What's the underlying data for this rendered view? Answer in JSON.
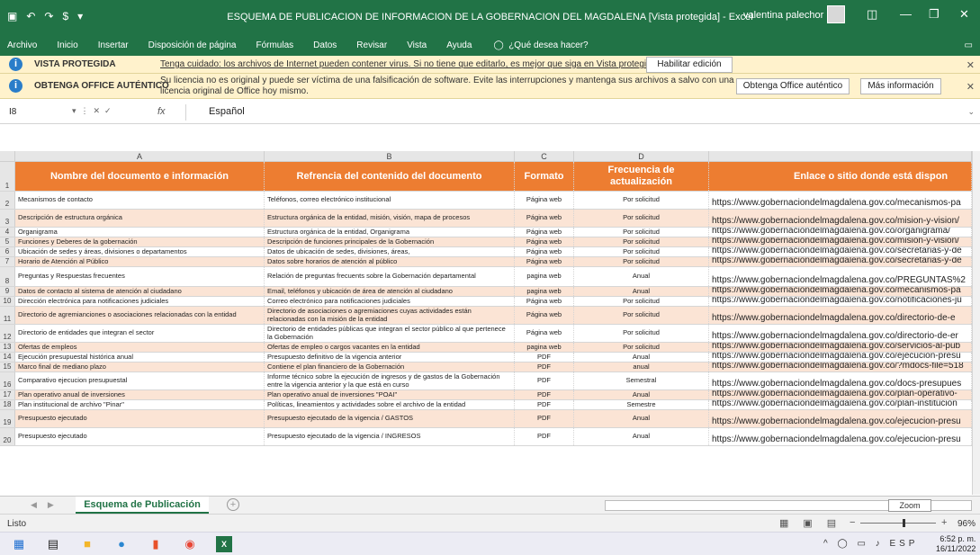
{
  "window": {
    "title": "ESQUEMA DE PUBLICACION DE INFORMACION DE LA GOBERNACION DEL MAGDALENA  [Vista protegida]  -  Excel",
    "user": "valentina palechor"
  },
  "ribbon": {
    "tabs": [
      "Archivo",
      "Inicio",
      "Insertar",
      "Disposición de página",
      "Fórmulas",
      "Datos",
      "Revisar",
      "Vista",
      "Ayuda"
    ],
    "tell_me": "¿Qué desea hacer?"
  },
  "protected_bar": {
    "label": "VISTA PROTEGIDA",
    "message": "Tenga cuidado: los archivos de Internet pueden contener virus. Si no tiene que editarlo, es mejor que siga en Vista protegida.",
    "button": "Habilitar edición"
  },
  "office_bar": {
    "label": "OBTENGA OFFICE AUTÉNTICO",
    "message_line1": "Su licencia no es original y puede ser víctima de una falsificación de software. Evite las interrupciones y mantenga sus archivos a salvo con una",
    "message_line2": "licencia original de Office hoy mismo.",
    "button1": "Obtenga Office auténtico",
    "button2": "Más información"
  },
  "formula_bar": {
    "name_box": "I8",
    "fx": "fx",
    "value": "Español"
  },
  "columns": [
    "A",
    "B",
    "C",
    "D"
  ],
  "header": {
    "row": "1",
    "a": "Nombre del documento e información",
    "b": "Refrencia del contenido del documento",
    "c": "Formato",
    "d": "Frecuencia de actualización",
    "e": "Enlace o sitio donde está dispon"
  },
  "rows": [
    {
      "n": "2",
      "a": "Mecanismos de contacto",
      "b": "Teléfonos, correo electrónico institucional",
      "c": "Página web",
      "d": "Por solicitud",
      "e": "https://www.gobernaciondelmagdalena.gov.co/mecanismos-pa"
    },
    {
      "n": "3",
      "a": "Descripción de estructura orgánica",
      "b": "Estructura orgánica de la entidad, misión, visión, mapa de procesos",
      "c": "Página web",
      "d": "Por solicitud",
      "e": "https://www.gobernaciondelmagdalena.gov.co/mision-y-vision/"
    },
    {
      "n": "4",
      "a": "Organigrama",
      "b": "Estructura orgánica de la entidad,  Organigrama",
      "c": "Página web",
      "d": "Por solicitud",
      "e": "https://www.gobernaciondelmagdalena.gov.co/organigrama/"
    },
    {
      "n": "5",
      "a": "Funciones y Deberes de la gobernación",
      "b": "Descripción de funciones principales de la Gobernación",
      "c": "Página web",
      "d": "Por solicitud",
      "e": "https://www.gobernaciondelmagdalena.gov.co/mision-y-vision/"
    },
    {
      "n": "6",
      "a": "Ubicación de sedes y áreas, divisiones o departamentos",
      "b": "Datos de ubicación de sedes, divisiones, áreas,",
      "c": "Página web",
      "d": "Por solicitud",
      "e": "https://www.gobernaciondelmagdalena.gov.co/secretarias-y-de"
    },
    {
      "n": "7",
      "a": "Horario de Atención al Público",
      "b": "Datos sobre horarios de atención al público",
      "c": "Página web",
      "d": "Por solicitud",
      "e": "https://www.gobernaciondelmagdalena.gov.co/secretarias-y-de"
    },
    {
      "n": "8",
      "a": "Preguntas y Respuestas frecuentes",
      "b": "Relación de preguntas frecuents sobre la Gobernación departamental",
      "c": "pagina web",
      "d": "Anual",
      "e": "https://www.gobernaciondelmagdalena.gov.co/PREGUNTAS%2"
    },
    {
      "n": "9",
      "a": "Datos de contacto al sistema de atención al ciudadano",
      "b": "Email, teléfonos y ubicación de área de atención al ciudadano",
      "c": "pagina web",
      "d": "Anual",
      "e": "https://www.gobernaciondelmagdalena.gov.co/mecanismos-pa"
    },
    {
      "n": "10",
      "a": "Dirección electrónica para notificaciones judiciales",
      "b": "Correo electrónico para notificaciones judiciales",
      "c": "Página web",
      "d": "Por solicitud",
      "e": "https://www.gobernaciondelmagdalena.gov.co/notificaciones-ju"
    },
    {
      "n": "11",
      "a": "Directorio de agremianciones o asociaciones relacionadas con la entidad",
      "b": "Directorio de asociaciones o agremiaciones cuyas actividades están relacionadas con la misión de la entidad",
      "c": "Página web",
      "d": "Por solicitud",
      "e": "https://www.gobernaciondelmagdalena.gov.co/directorio-de-e"
    },
    {
      "n": "12",
      "a": "Directorio de entidades que integran el sector",
      "b": "Directorio de entidades públicas que integran el sector público al que pertenece la Gobernación",
      "c": "Página web",
      "d": "Por solicitud",
      "e": "https://www.gobernaciondelmagdalena.gov.co/directorio-de-er"
    },
    {
      "n": "13",
      "a": "Ofertas de empleos",
      "b": "Ofertas de empleo o cargos vacantes en la entidad",
      "c": "pagina web",
      "d": "Por solicitud",
      "e": "https://www.gobernaciondelmagdalena.gov.co/servicios-al-pub"
    },
    {
      "n": "14",
      "a": "Ejecución presupuestal histórica anual",
      "b": "Presupuesto definitivo de la vigencia anterior",
      "c": "PDF",
      "d": "Anual",
      "e": "https://www.gobernaciondelmagdalena.gov.co/ejecucion-presu"
    },
    {
      "n": "15",
      "a": "Marco final de mediano plazo",
      "b": "Contiene el plan financiero de la Gobernación",
      "c": "PDF",
      "d": "anual",
      "e": "https://www.gobernaciondelmagdalena.gov.co/?mdocs-file=518"
    },
    {
      "n": "16",
      "a": "Comparativo ejecucion presupuestal",
      "b": "Informe técnico sobre la ejecución de ingresos y de gastos de la Gobernación entre la vigencia anterior y la que está en curso",
      "c": "PDF",
      "d": "Semestral",
      "e": "https://www.gobernaciondelmagdalena.gov.co/docs-presupues"
    },
    {
      "n": "17",
      "a": "Plan operativo anual de inversiones",
      "b": "Plan operativo anual de inversiones \"POAI\"",
      "c": "PDF",
      "d": "Anual",
      "e": "https://www.gobernaciondelmagdalena.gov.co/plan-operativo-"
    },
    {
      "n": "18",
      "a": "Plan institucional de archivo \"Pinar\"",
      "b": "Políticas, lineamientos y actividades sobre el archivo de la entidad",
      "c": "PDF",
      "d": "Semestre",
      "e": "https://www.gobernaciondelmagdalena.gov.co/plan-institucion"
    },
    {
      "n": "19",
      "a": "Presupuesto ejecutado",
      "b": "Presupuesto ejecutado de la vigencia / GASTOS",
      "c": "PDF",
      "d": "Anual",
      "e": "https://www.gobernaciondelmagdalena.gov.co/ejecucion-presu"
    },
    {
      "n": "20",
      "a": "Presupuesto ejecutado",
      "b": "Presupuesto ejecutado de la vigencia / INGRESOS",
      "c": "PDF",
      "d": "Anual",
      "e": "https://www.gobernaciondelmagdalena.gov.co/ejecucion-presu"
    }
  ],
  "sheet_tab": "Esquema de Publicación",
  "tooltip": "Zoom",
  "status": {
    "ready": "Listo",
    "zoom": "96%"
  },
  "taskbar": {
    "lang": "ESP",
    "time": "6:52 p. m.",
    "date": "16/11/2022"
  },
  "colors": {
    "excel_green": "#217346",
    "header_orange": "#ed7d31",
    "band_peach": "#fbe4d5",
    "message_yellow": "#fff2cc"
  }
}
